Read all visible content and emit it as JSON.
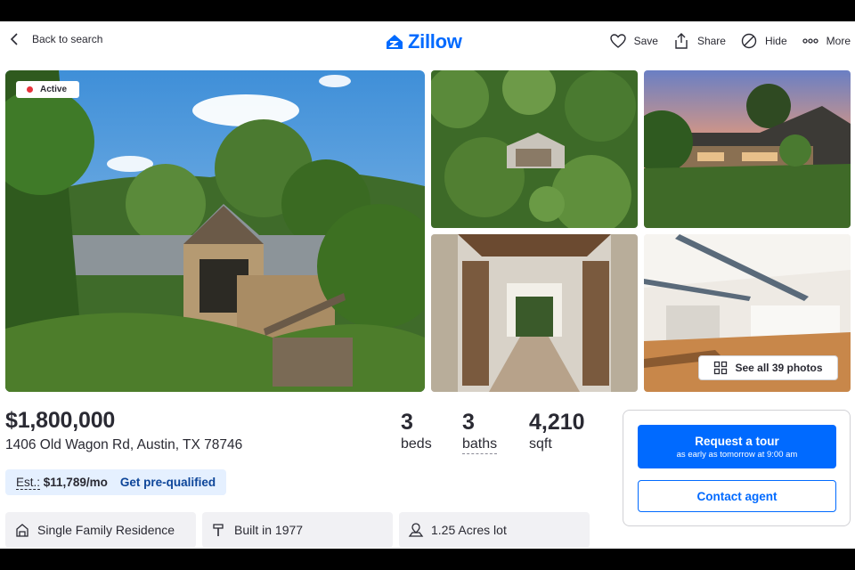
{
  "header": {
    "back_label": "Back to search",
    "logo_text": "Zillow",
    "actions": {
      "save": "Save",
      "share": "Share",
      "hide": "Hide",
      "more": "More"
    }
  },
  "photos": {
    "status_badge": "Active",
    "see_all_label": "See all 39 photos"
  },
  "listing": {
    "price": "$1,800,000",
    "address": "1406 Old Wagon Rd, Austin, TX 78746",
    "beds": {
      "value": "3",
      "label": "beds"
    },
    "baths": {
      "value": "3",
      "label": "baths"
    },
    "sqft": {
      "value": "4,210",
      "label": "sqft"
    },
    "estimate": {
      "label": "Est.:",
      "amount": "$11,789/mo",
      "link": "Get pre-qualified"
    }
  },
  "highlights": [
    {
      "icon": "house-icon",
      "text": "Single Family Residence"
    },
    {
      "icon": "hammer-icon",
      "text": "Built in 1977"
    },
    {
      "icon": "lot-icon",
      "text": "1.25 Acres lot"
    }
  ],
  "contact_card": {
    "tour_title": "Request a tour",
    "tour_subtitle": "as early as tomorrow at 9:00 am",
    "contact_label": "Contact agent"
  },
  "colors": {
    "brand": "#006aff",
    "status_active": "#e7323b",
    "estimate_bg": "#e5f0ff"
  }
}
